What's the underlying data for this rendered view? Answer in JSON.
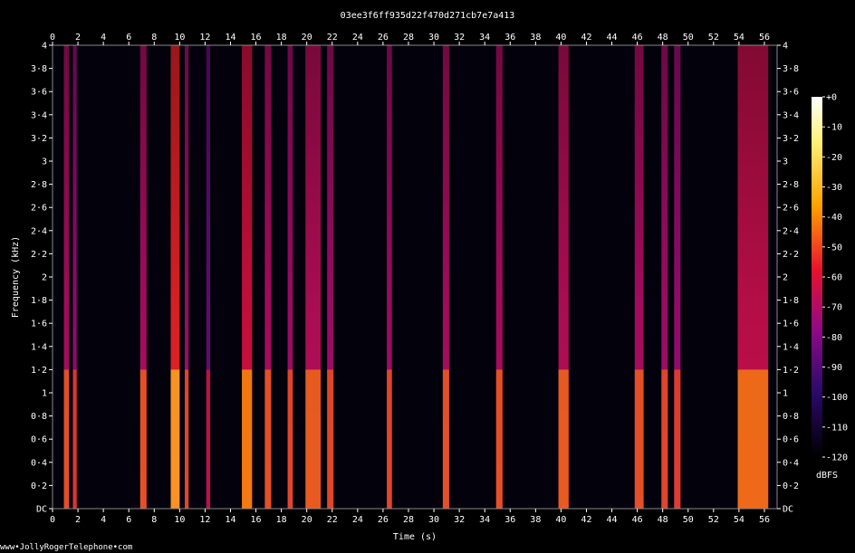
{
  "chart_data": {
    "type": "heatmap",
    "title": "03ee3f6ff935d22f470d271cb7e7a413",
    "xlabel": "Time (s)",
    "ylabel": "Frequency (kHz)",
    "xlim": [
      0,
      57
    ],
    "ylim": [
      0,
      4
    ],
    "x_ticks": [
      "0",
      "2",
      "4",
      "6",
      "8",
      "10",
      "12",
      "14",
      "16",
      "18",
      "20",
      "22",
      "24",
      "26",
      "28",
      "30",
      "32",
      "34",
      "36",
      "38",
      "40",
      "42",
      "44",
      "46",
      "48",
      "50",
      "52",
      "54",
      "56"
    ],
    "y_ticks": [
      "DC",
      "0·2",
      "0·4",
      "0·6",
      "0·8",
      "1",
      "1·2",
      "1·4",
      "1·6",
      "1·8",
      "2",
      "2·2",
      "2·4",
      "2·6",
      "2·8",
      "3",
      "3·2",
      "3·4",
      "3·6",
      "3·8",
      "4"
    ],
    "colorbar": {
      "label": "dBFS",
      "range": [
        -120,
        0
      ],
      "ticks": [
        "+0",
        "-10",
        "-20",
        "-30",
        "-40",
        "-50",
        "-60",
        "-70",
        "-80",
        "-90",
        "-100",
        "-110",
        "-120"
      ]
    },
    "segments": [
      {
        "start": 0.9,
        "end": 1.3,
        "level": -70
      },
      {
        "start": 1.6,
        "end": 1.9,
        "level": -75
      },
      {
        "start": 6.9,
        "end": 7.4,
        "level": -70
      },
      {
        "start": 9.3,
        "end": 10.0,
        "level": -55
      },
      {
        "start": 10.4,
        "end": 10.7,
        "level": -72
      },
      {
        "start": 12.1,
        "end": 12.4,
        "level": -85
      },
      {
        "start": 14.9,
        "end": 15.7,
        "level": -62
      },
      {
        "start": 16.7,
        "end": 17.2,
        "level": -70
      },
      {
        "start": 18.5,
        "end": 18.9,
        "level": -72
      },
      {
        "start": 19.9,
        "end": 21.1,
        "level": -68
      },
      {
        "start": 21.6,
        "end": 22.1,
        "level": -72
      },
      {
        "start": 26.3,
        "end": 26.7,
        "level": -72
      },
      {
        "start": 30.7,
        "end": 31.2,
        "level": -70
      },
      {
        "start": 34.9,
        "end": 35.4,
        "level": -70
      },
      {
        "start": 39.8,
        "end": 40.6,
        "level": -68
      },
      {
        "start": 45.8,
        "end": 46.5,
        "level": -70
      },
      {
        "start": 47.9,
        "end": 48.4,
        "level": -72
      },
      {
        "start": 48.9,
        "end": 49.4,
        "level": -74
      },
      {
        "start": 53.9,
        "end": 56.3,
        "level": -65
      }
    ]
  },
  "watermark": "www•JollyRogerTelephone•com"
}
